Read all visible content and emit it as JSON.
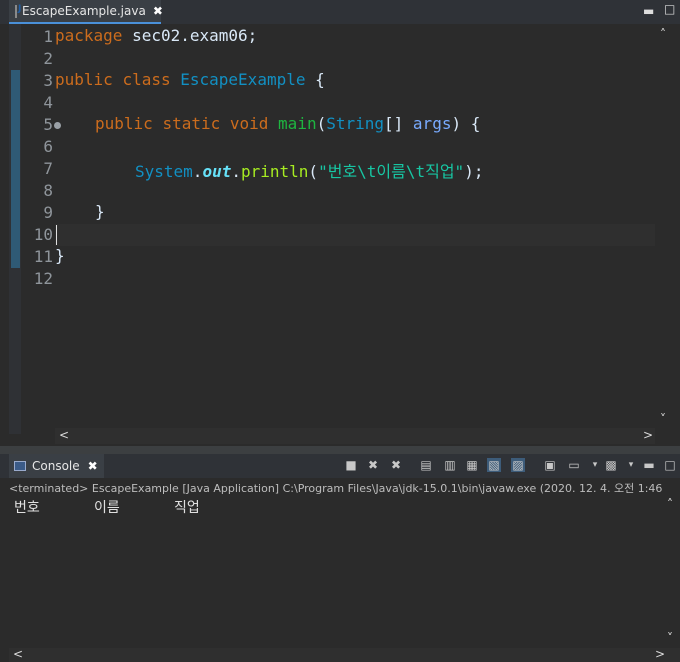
{
  "editor": {
    "tab_label": "EscapeExample.java",
    "tab_close": "✖",
    "window_controls": {
      "minimize": "▬",
      "maximize": "□"
    },
    "line_numbers": [
      "1",
      "2",
      "3",
      "4",
      "5",
      "6",
      "7",
      "8",
      "9",
      "10",
      "11",
      "12"
    ],
    "code": {
      "l1_kw": "package",
      "l1_rest": " sec02.exam06;",
      "l3_kw1": "public",
      "l3_kw2": "class",
      "l3_cls": "EscapeExample",
      "l3_rest": " {",
      "l5_kw1": "public",
      "l5_kw2": "static",
      "l5_kw3": "void",
      "l5_mth": "main",
      "l5_p1": "(",
      "l5_type": "String",
      "l5_p2": "[] ",
      "l5_var": "args",
      "l5_rest": ") {",
      "l7_cls": "System",
      "l7_dot1": ".",
      "l7_fld": "out",
      "l7_dot2": ".",
      "l7_mth": "println",
      "l7_p1": "(",
      "l7_str": "\"번호\\t이름\\t직업\"",
      "l7_rest": ");",
      "l9": "}",
      "l11": "}"
    }
  },
  "console": {
    "tab_label": "Console",
    "tab_close": "✖",
    "status": "<terminated> EscapeExample [Java Application] C:\\Program Files\\Java\\jdk-15.0.1\\bin\\javaw.exe  (2020. 12. 4. 오전 1:46",
    "output": [
      "번호",
      "이름",
      "직업"
    ]
  }
}
